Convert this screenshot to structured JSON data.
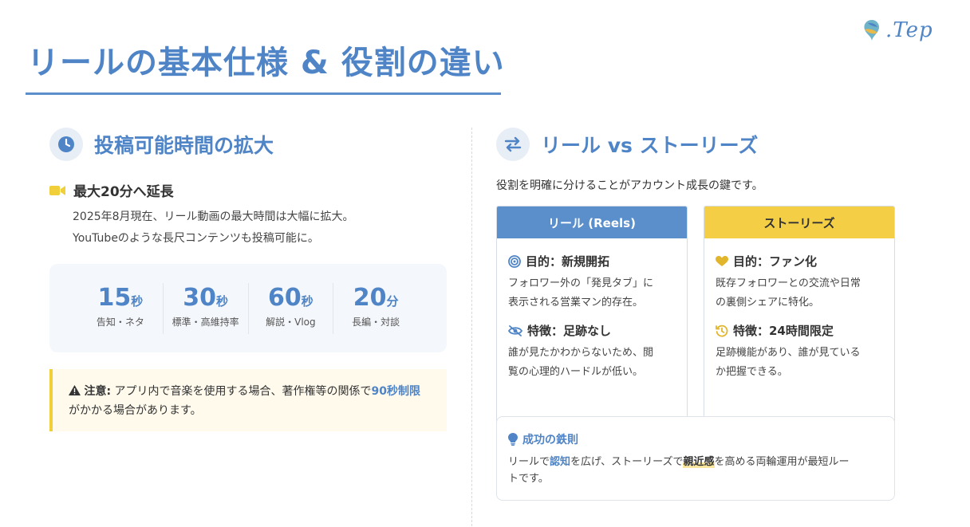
{
  "logo": {
    "text": ".Tep"
  },
  "page_title": "リールの基本仕様 & 役割の違い",
  "left": {
    "section_title": "投稿可能時間の拡大",
    "subhead": "最大20分へ延長",
    "desc_line1": "2025年8月現在、リール動画の最大時間は大幅に拡大。",
    "desc_line2": "YouTubeのような長尺コンテンツも投稿可能に。",
    "stats": [
      {
        "num": "15",
        "unit": "秒",
        "label": "告知・ネタ"
      },
      {
        "num": "30",
        "unit": "秒",
        "label": "標準・高維持率"
      },
      {
        "num": "60",
        "unit": "秒",
        "label": "解説・Vlog"
      },
      {
        "num": "20",
        "unit": "分",
        "label": "長編・対談"
      }
    ],
    "note": {
      "label": "注意:",
      "text1": " アプリ内で音楽を使用する場合、著作権等の関係で",
      "highlight": "90秒制限",
      "text2": "がかかる場合があります。"
    }
  },
  "right": {
    "section_title": "リール vs ストーリーズ",
    "lead": "役割を明確に分けることがアカウント成長の鍵です。",
    "reels": {
      "header": "リール (Reels)",
      "p1_title": "目的：新規開拓",
      "p1_line1": "フォロワー外の「発見タブ」に",
      "p1_line2": "表示される営業マン的存在。",
      "p2_title": "特徴：足跡なし",
      "p2_line1": "誰が見たかわからないため、閲",
      "p2_line2": "覧の心理的ハードルが低い。"
    },
    "stories": {
      "header": "ストーリーズ",
      "p1_title": "目的：ファン化",
      "p1_line1": "既存フォロワーとの交流や日常",
      "p1_line2": "の裏側シェアに特化。",
      "p2_title": "特徴：24時間限定",
      "p2_line1": "足跡機能があり、誰が見ている",
      "p2_line2": "か把握できる。"
    },
    "tip": {
      "title": "成功の鉄則",
      "t1": "リールで",
      "h1": "認知",
      "t2": "を広げ、ストーリーズで",
      "h2": "親近感",
      "t3": "を高める両輪運用が最短ルー",
      "t4": "トです。"
    }
  },
  "colors": {
    "accent": "#4f84c6",
    "yellow": "#f4cf45"
  },
  "icons": [
    "clock-icon",
    "video-camera-icon",
    "warning-icon",
    "swap-arrows-icon",
    "target-icon",
    "eye-slash-icon",
    "heart-icon",
    "history-icon",
    "lightbulb-icon"
  ]
}
